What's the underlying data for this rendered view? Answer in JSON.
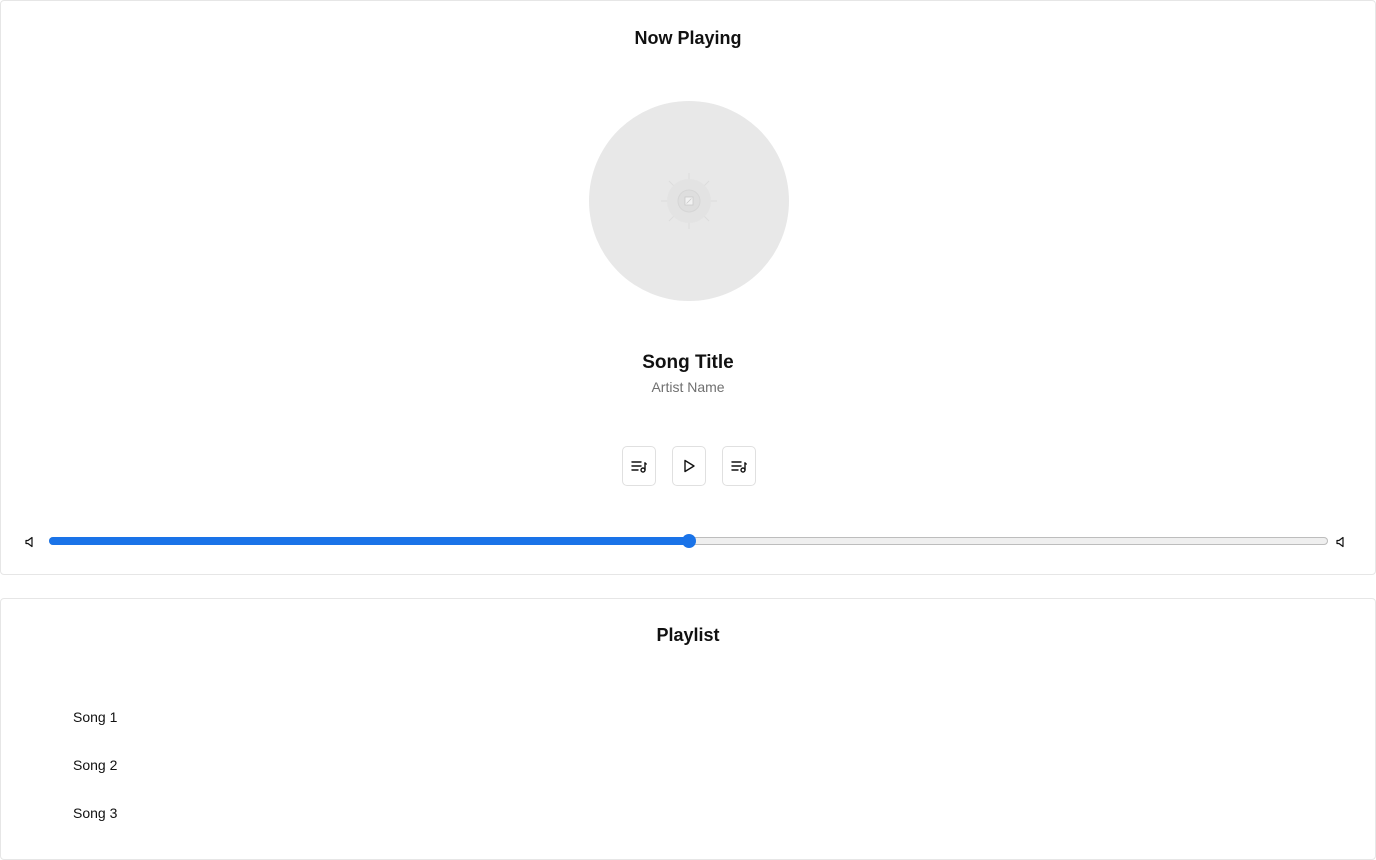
{
  "now_playing": {
    "title": "Now Playing",
    "song_title": "Song Title",
    "artist_name": "Artist Name",
    "controls": {
      "previous_icon": "playlist-music-icon",
      "play_icon": "play-icon",
      "next_icon": "playlist-music-icon"
    },
    "volume": {
      "low_icon": "volume-low-icon",
      "high_icon": "volume-high-icon",
      "level_fraction": 0.5
    },
    "accent_color": "#1a73e8"
  },
  "playlist": {
    "title": "Playlist",
    "items": [
      {
        "label": "Song 1"
      },
      {
        "label": "Song 2"
      },
      {
        "label": "Song 3"
      }
    ]
  }
}
